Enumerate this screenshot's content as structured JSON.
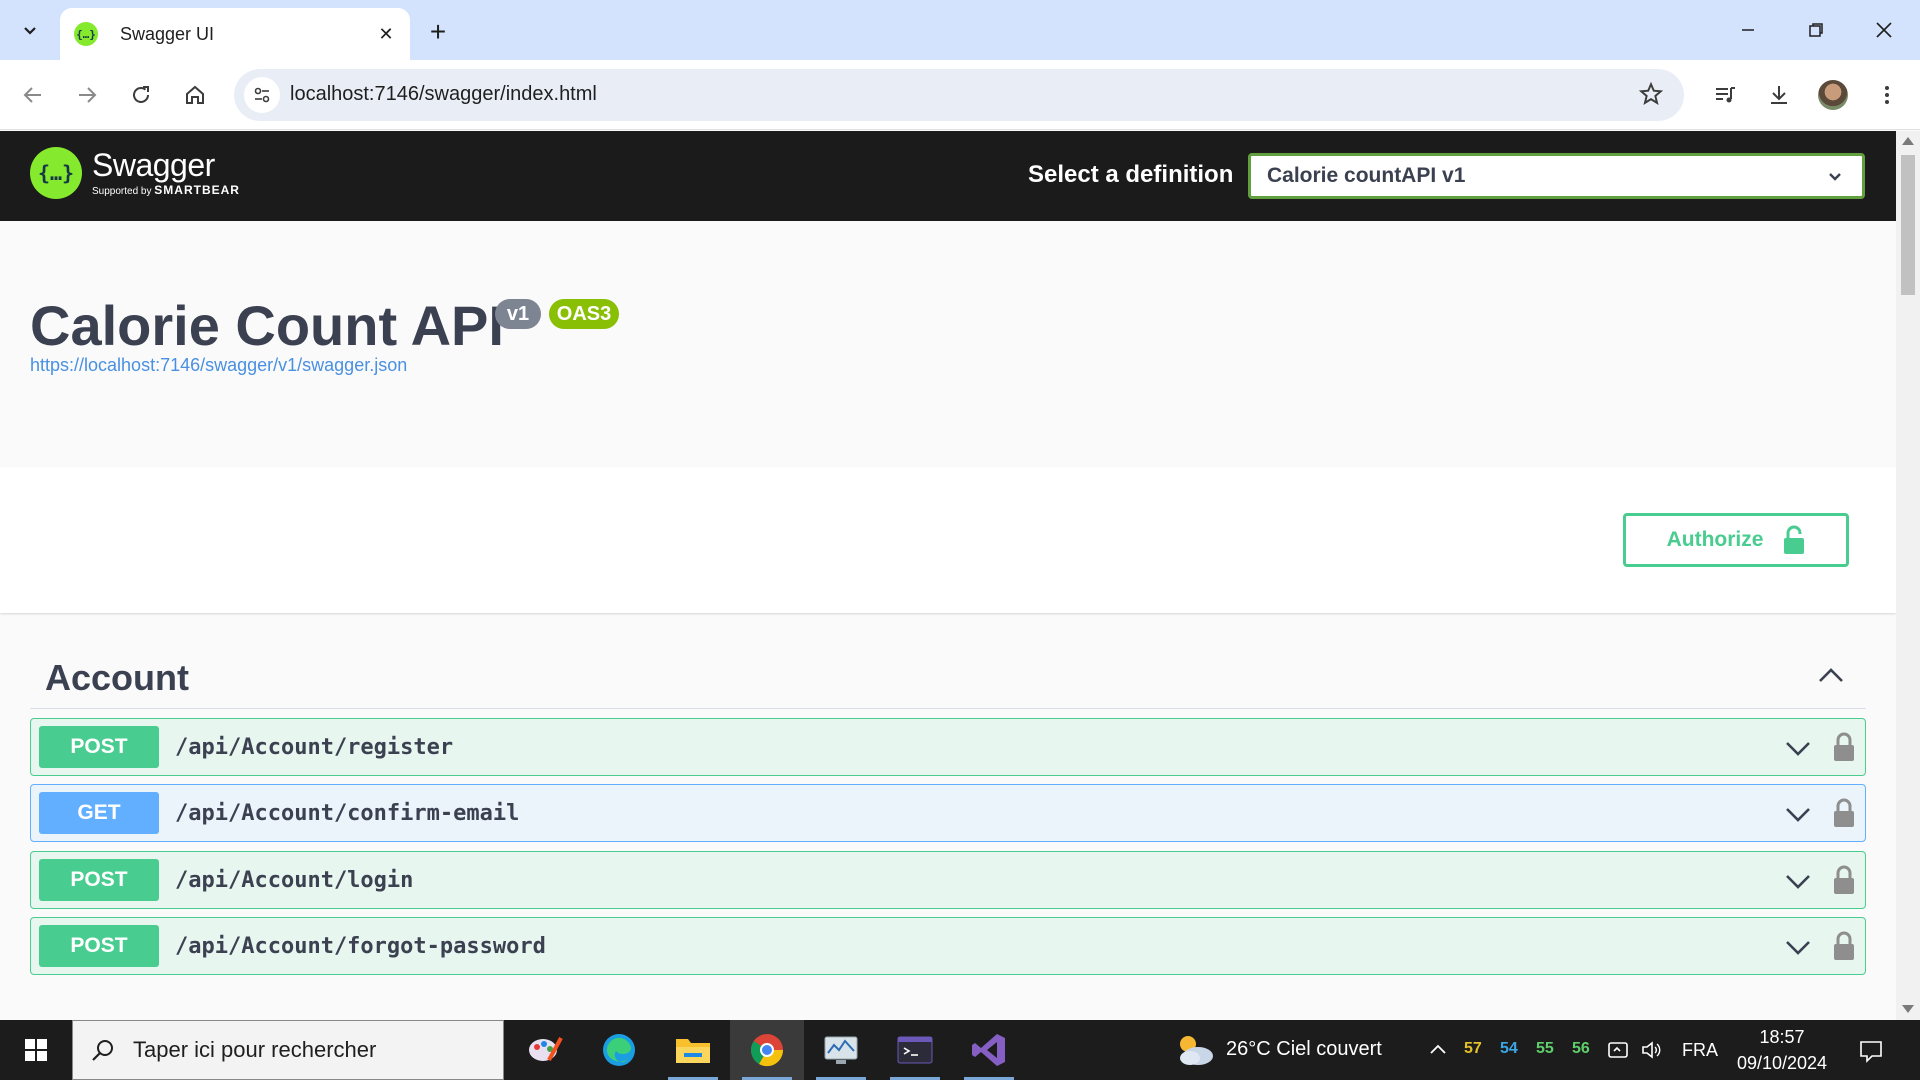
{
  "browser": {
    "tab_title": "Swagger UI",
    "tab_favicon_text": "{…}",
    "url": "localhost:7146/swagger/index.html"
  },
  "swagger": {
    "logo_word": "Swagger",
    "logo_icon_text": "{…}",
    "logo_supported_prefix": "Supported by",
    "logo_supported_brand": "SMARTBEAR",
    "select_label": "Select a definition",
    "selected_definition": "Calorie countAPI v1"
  },
  "info": {
    "title": "Calorie Count API",
    "version_badge": "v1",
    "oas_badge": "OAS3",
    "spec_url": "https://localhost:7146/swagger/v1/swagger.json"
  },
  "authorize": {
    "label": "Authorize"
  },
  "tag": {
    "name": "Account",
    "operations": [
      {
        "method": "POST",
        "path": "/api/Account/register"
      },
      {
        "method": "GET",
        "path": "/api/Account/confirm-email"
      },
      {
        "method": "POST",
        "path": "/api/Account/login"
      },
      {
        "method": "POST",
        "path": "/api/Account/forgot-password"
      }
    ]
  },
  "taskbar": {
    "search_placeholder": "Taper ici pour rechercher",
    "weather": "26°C  Ciel couvert",
    "tray_numbers": [
      "57",
      "54",
      "55",
      "56"
    ],
    "language": "FRA",
    "time": "18:57",
    "date": "09/10/2024"
  },
  "colors": {
    "post": "#49cc90",
    "get": "#61affe",
    "swagger_green": "#85ea2d",
    "topbar": "#1b1b1b"
  }
}
